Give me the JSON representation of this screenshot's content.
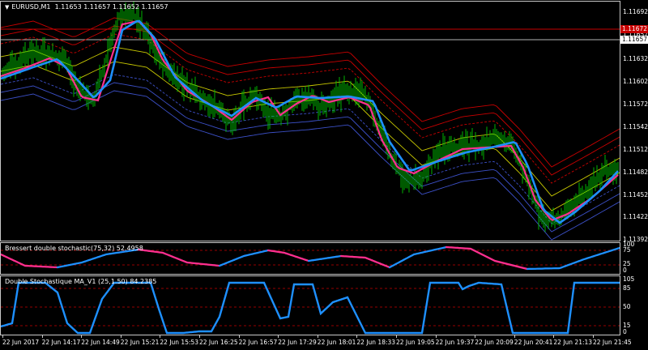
{
  "main": {
    "symbol": "EURUSD,M1",
    "ohlc": "1.11653 1.11657 1.11652 1.11657",
    "price_labels": [
      "1.11692",
      "1.11657",
      "1.11632",
      "1.11602",
      "1.11572",
      "1.11542",
      "1.11512",
      "1.11482",
      "1.11452",
      "1.11422",
      "1.11392"
    ],
    "bid_tag": "1.11672",
    "ask_tag": "1.11657",
    "colors": {
      "candles": "#00c800",
      "fast_ma": "#ff2f8f",
      "signal": "#1e90ff",
      "upper_band": "#c80000",
      "mid_band": "#c8c800",
      "lower_band": "#3c50c8"
    }
  },
  "ind1": {
    "title": "Bressert double stochastic(75,32) 52.4958",
    "axis": [
      "100",
      "75",
      "25",
      "0"
    ]
  },
  "ind2": {
    "title": "Double Stochastique MA_V1 (25,1.50) 84.2385",
    "axis": [
      "105",
      "85",
      "50",
      "15",
      "0"
    ]
  },
  "time_labels": [
    "22 Jun 2017",
    "22 Jun 14:17",
    "22 Jun 14:49",
    "22 Jun 15:21",
    "22 Jun 15:53",
    "22 Jun 16:25",
    "22 Jun 16:57",
    "22 Jun 17:29",
    "22 Jun 18:01",
    "22 Jun 18:33",
    "22 Jun 19:05",
    "22 Jun 19:37",
    "22 Jun 20:09",
    "22 Jun 20:41",
    "22 Jun 21:13",
    "22 Jun 21:45"
  ]
}
